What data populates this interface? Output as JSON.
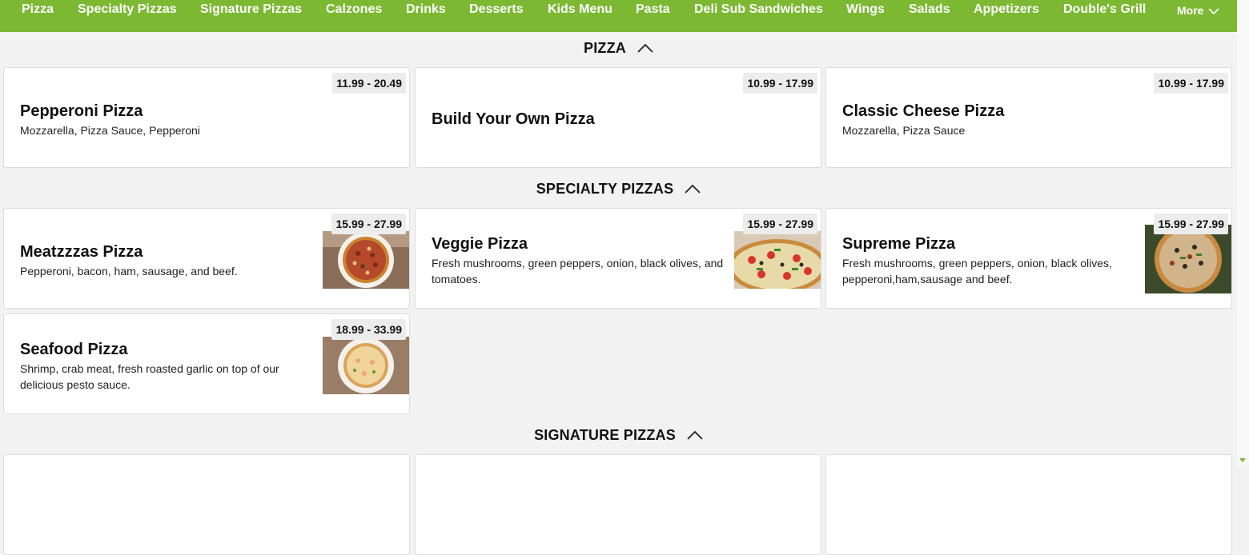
{
  "nav": {
    "items": [
      "Pizza",
      "Specialty Pizzas",
      "Signature Pizzas",
      "Calzones",
      "Drinks",
      "Desserts",
      "Kids Menu",
      "Pasta",
      "Deli Sub Sandwiches",
      "Wings",
      "Salads",
      "Appetizers",
      "Double's Grill"
    ],
    "more_label": "More"
  },
  "sections": [
    {
      "title": "PIZZA",
      "items": [
        {
          "name": "Pepperoni Pizza",
          "desc": "Mozzarella, Pizza Sauce, Pepperoni",
          "price": "11.99 - 20.49"
        },
        {
          "name": "Build Your Own Pizza",
          "desc": "",
          "price": "10.99 - 17.99"
        },
        {
          "name": "Classic Cheese Pizza",
          "desc": "Mozzarella, Pizza Sauce",
          "price": "10.99 - 17.99"
        }
      ]
    },
    {
      "title": "SPECIALTY PIZZAS",
      "items": [
        {
          "name": "Meatzzzas Pizza",
          "desc": "Pepperoni, bacon, ham, sausage, and beef.",
          "price": "15.99 - 27.99",
          "image": "meat-pizza-photo"
        },
        {
          "name": "Veggie Pizza",
          "desc": "Fresh mushrooms, green peppers, onion, black olives, and tomatoes.",
          "price": "15.99 - 27.99",
          "image": "veggie-pizza-photo"
        },
        {
          "name": "Supreme Pizza",
          "desc": "Fresh mushrooms, green peppers, onion, black olives, pepperoni,ham,sausage and beef.",
          "price": "15.99 - 27.99",
          "image": "supreme-pizza-photo"
        },
        {
          "name": "Seafood Pizza",
          "desc": "Shrimp, crab meat, fresh roasted garlic on top of our delicious pesto sauce.",
          "price": "18.99 - 33.99",
          "image": "seafood-pizza-photo"
        }
      ]
    },
    {
      "title": "SIGNATURE PIZZAS",
      "items": []
    }
  ],
  "colors": {
    "nav_bg": "#7cb832",
    "nav_text": "#ffffff",
    "page_bg": "#f2f2f2",
    "card_bg": "#ffffff",
    "price_bg": "#ececec"
  },
  "icons": {
    "more": "chevron-down-icon",
    "collapse": "chevron-up-icon"
  }
}
